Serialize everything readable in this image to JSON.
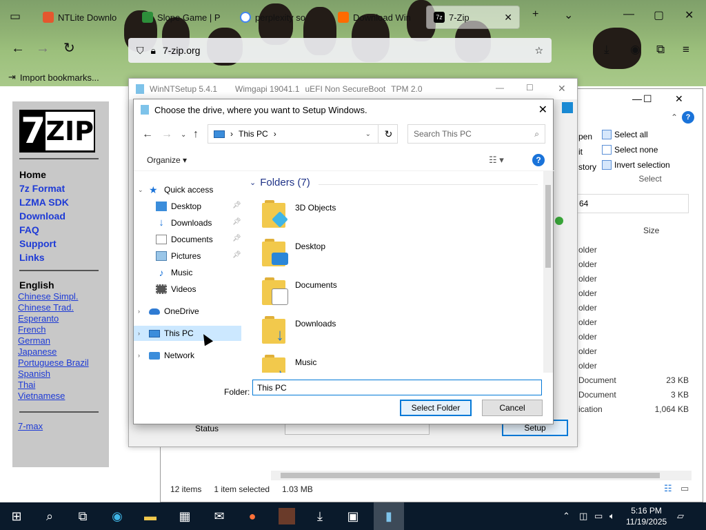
{
  "browser": {
    "tabs": [
      {
        "label": "NTLite Downlo",
        "favicon_color": "#e4572e"
      },
      {
        "label": "Slope Game | P",
        "favicon_color": "#2d8f3a"
      },
      {
        "label": "perplexity so",
        "favicon_color": "#4285f4"
      },
      {
        "label": "Download Win",
        "favicon_color": "#ff6a00"
      },
      {
        "label": "7-Zip",
        "favicon_color": "#000000"
      }
    ],
    "url": "7-zip.org",
    "bookmarks_import": "Import bookmarks..."
  },
  "site": {
    "logo_seven": "7",
    "logo_zip": "ZIP",
    "nav": [
      "Home",
      "7z Format",
      "LZMA SDK",
      "Download",
      "FAQ",
      "Support",
      "Links"
    ],
    "lang_heading": "English",
    "languages": [
      "Chinese Simpl.",
      "Chinese Trad.",
      "Esperanto",
      "French",
      "German",
      "Japanese",
      "Portuguese Brazil",
      "Spanish",
      "Thai",
      "Vietnamese"
    ],
    "extra_link": "7-max"
  },
  "explorer": {
    "ribbon": {
      "select_all": "Select all",
      "select_none": "Select none",
      "invert_selection": "Invert selection",
      "group_label": "Select",
      "open_fragment": "pen",
      "edit_fragment": "it",
      "history_fragment": "story"
    },
    "search_fragment": "64",
    "size_header": "Size",
    "file_rows": [
      {
        "type": "older",
        "size": ""
      },
      {
        "type": "older",
        "size": ""
      },
      {
        "type": "older",
        "size": ""
      },
      {
        "type": "older",
        "size": ""
      },
      {
        "type": "older",
        "size": ""
      },
      {
        "type": "older",
        "size": ""
      },
      {
        "type": "older",
        "size": ""
      },
      {
        "type": "older",
        "size": ""
      },
      {
        "type": "older",
        "size": ""
      },
      {
        "type": "Document",
        "size": "23 KB"
      },
      {
        "type": "Document",
        "size": "3 KB"
      },
      {
        "type": "ication",
        "size": "1,064 KB"
      }
    ],
    "status_items": "12 items",
    "status_selected": "1 item selected",
    "status_size": "1.03 MB"
  },
  "winnt": {
    "title": "WinNTSetup 5.4.1",
    "wimgapi": "Wimgapi 19041.1",
    "boot": "uEFI Non SecureBoot",
    "tpm": "TPM 2.0",
    "status_label": "Status",
    "setup_button": "Setup"
  },
  "dialog": {
    "title": "Choose the drive, where you want to Setup Windows.",
    "address": "This PC",
    "search_placeholder": "Search This PC",
    "organize": "Organize",
    "nav": {
      "quick_access": "Quick access",
      "desktop": "Desktop",
      "downloads": "Downloads",
      "documents": "Documents",
      "pictures": "Pictures",
      "music": "Music",
      "videos": "Videos",
      "onedrive": "OneDrive",
      "this_pc": "This PC",
      "network": "Network"
    },
    "group_heading": "Folders (7)",
    "folders": [
      "3D Objects",
      "Desktop",
      "Documents",
      "Downloads",
      "Music"
    ],
    "folder_label": "Folder:",
    "folder_value": "This PC",
    "select_button": "Select Folder",
    "cancel_button": "Cancel"
  },
  "taskbar": {
    "time": "5:16 PM",
    "date": "11/19/2025"
  }
}
